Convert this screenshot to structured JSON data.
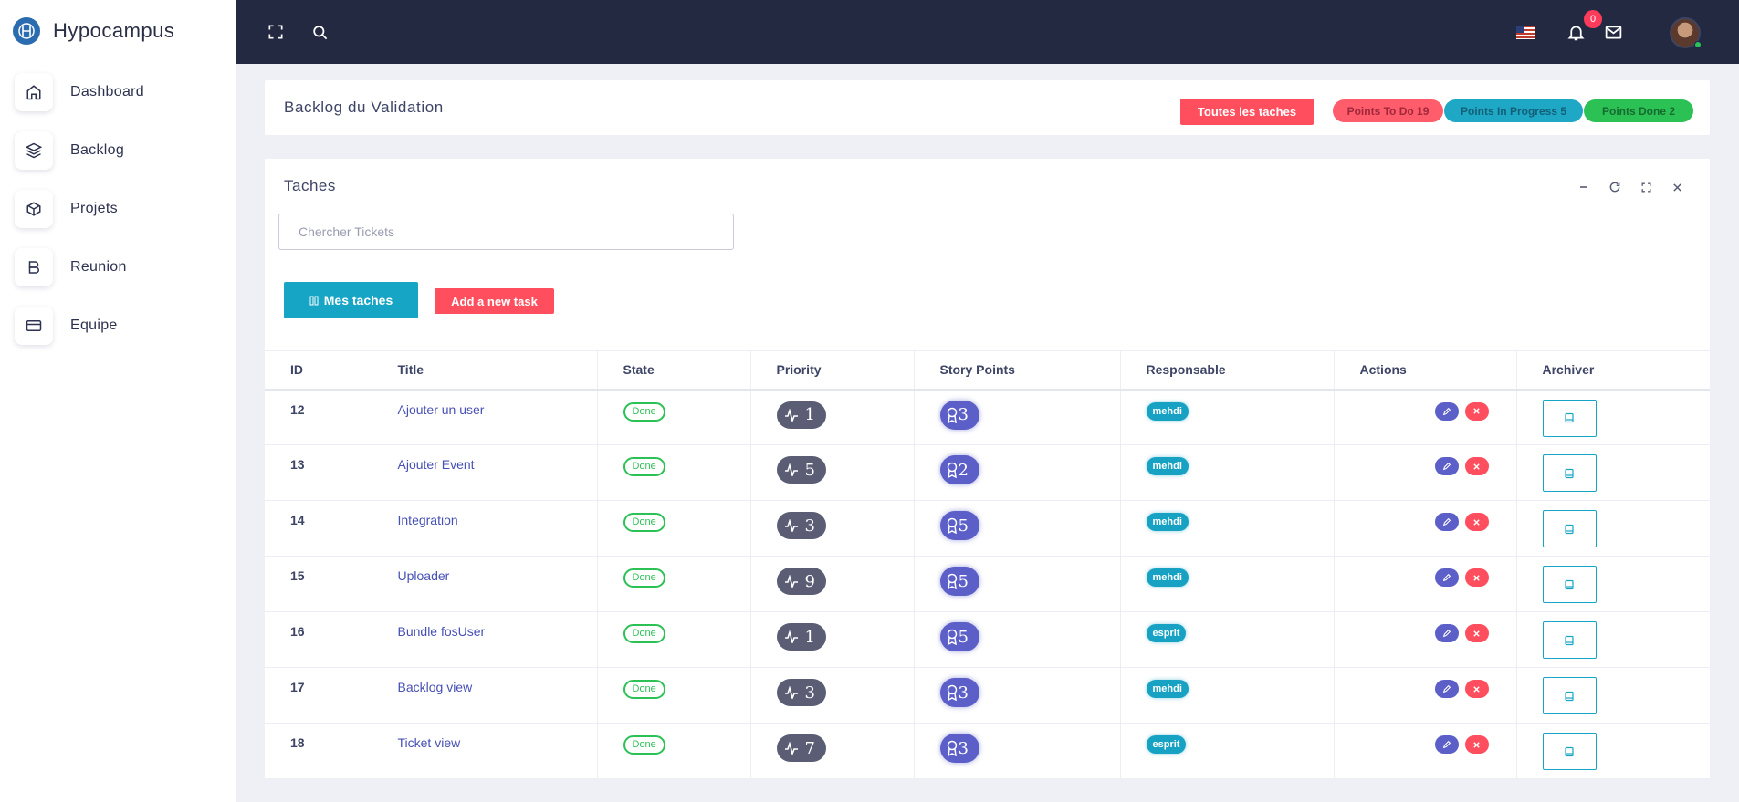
{
  "brand": {
    "name": "Hypocampus"
  },
  "sidebar": {
    "items": [
      {
        "label": "Dashboard",
        "icon": "home-icon"
      },
      {
        "label": "Backlog",
        "icon": "layers-icon"
      },
      {
        "label": "Projets",
        "icon": "box-icon"
      },
      {
        "label": "Reunion",
        "icon": "bold-b-icon"
      },
      {
        "label": "Equipe",
        "icon": "credit-card-icon"
      }
    ]
  },
  "topbar": {
    "notifications_count": "0",
    "language_flag": "us-flag-icon"
  },
  "header": {
    "title": "Backlog du Validation",
    "all_tasks_button": "Toutes les taches",
    "points_todo": "Points To Do 19",
    "points_in_progress": "Points In Progress 5",
    "points_done": "Points Done 2"
  },
  "tasks": {
    "title": "Taches",
    "search_placeholder": "Chercher Tickets",
    "my_tasks_button": "Mes taches",
    "add_task_button": "Add a new task",
    "columns": [
      "ID",
      "Title",
      "State",
      "Priority",
      "Story Points",
      "Responsable",
      "Actions",
      "Archiver"
    ],
    "rows": [
      {
        "id": "12",
        "title": "Ajouter un user",
        "state": "Done",
        "priority": "1",
        "story_points": "3",
        "responsable": "mehdi"
      },
      {
        "id": "13",
        "title": "Ajouter Event",
        "state": "Done",
        "priority": "5",
        "story_points": "2",
        "responsable": "mehdi"
      },
      {
        "id": "14",
        "title": "Integration",
        "state": "Done",
        "priority": "3",
        "story_points": "5",
        "responsable": "mehdi"
      },
      {
        "id": "15",
        "title": "Uploader",
        "state": "Done",
        "priority": "9",
        "story_points": "5",
        "responsable": "mehdi"
      },
      {
        "id": "16",
        "title": "Bundle fosUser",
        "state": "Done",
        "priority": "1",
        "story_points": "5",
        "responsable": "esprit"
      },
      {
        "id": "17",
        "title": "Backlog view",
        "state": "Done",
        "priority": "3",
        "story_points": "3",
        "responsable": "mehdi"
      },
      {
        "id": "18",
        "title": "Ticket view",
        "state": "Done",
        "priority": "7",
        "story_points": "3",
        "responsable": "esprit"
      }
    ]
  },
  "colors": {
    "topbar": "#232941",
    "accent_blue": "#16a5c5",
    "accent_red": "#ff4f5e",
    "accent_green": "#2bc155",
    "accent_purple": "#5b5fc7"
  }
}
